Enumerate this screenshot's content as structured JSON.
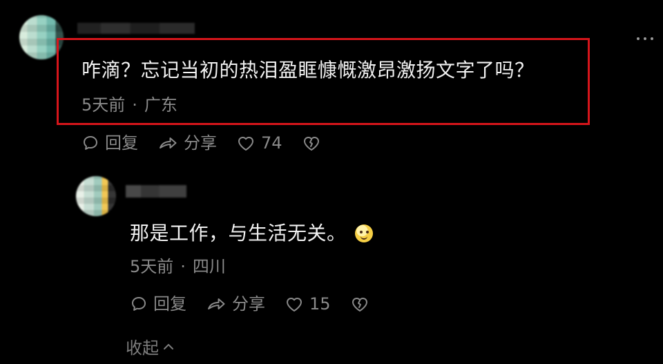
{
  "comment": {
    "text": "咋滴？忘记当初的热泪盈眶慷慨激昂激扬文字了吗？",
    "time": "5天前",
    "separator": "·",
    "location": "广东",
    "actions": {
      "reply_label": "回复",
      "share_label": "分享",
      "like_count": "74"
    }
  },
  "reply": {
    "text": "那是工作，与生活无关。",
    "time": "5天前",
    "separator": "·",
    "location": "四川",
    "actions": {
      "reply_label": "回复",
      "share_label": "分享",
      "like_count": "15"
    }
  },
  "footer": {
    "collapse_label": "收起"
  },
  "colors": {
    "background": "#000000",
    "highlight_border": "#d6151b",
    "primary_text": "#f2f2f2",
    "secondary_text": "#8a8a8a"
  },
  "icons": {
    "reply": "comment-bubble-icon",
    "share": "share-arrow-icon",
    "like": "heart-outline-icon",
    "dislike": "broken-heart-icon",
    "more": "more-dots-icon",
    "collapse": "chevron-up-icon",
    "emoji": "smile-emoji-icon"
  }
}
